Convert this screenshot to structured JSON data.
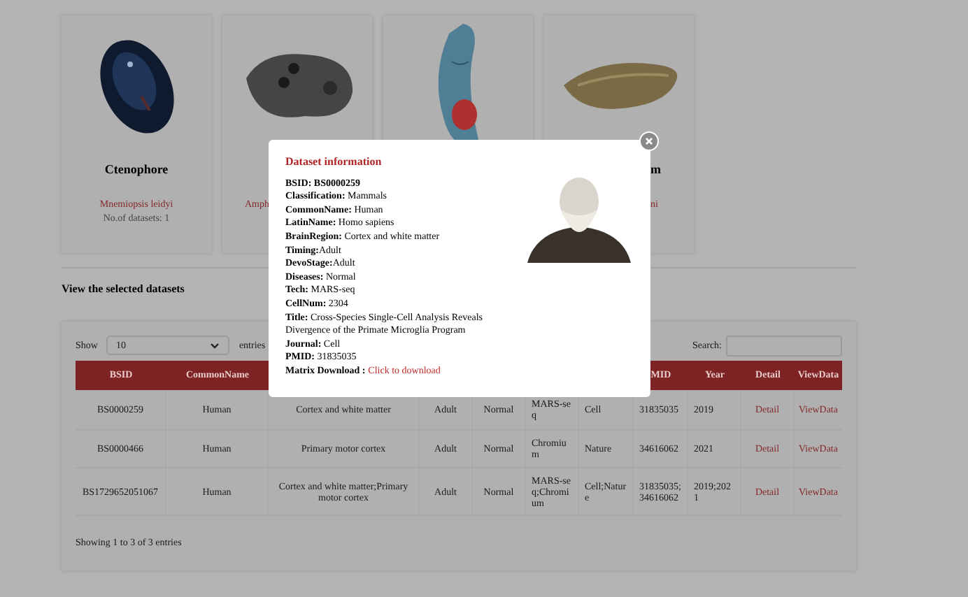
{
  "cards": [
    {
      "kind": "picture",
      "title": "Ctenophore",
      "species": "Mnemiopsis leidyi",
      "count": "No.of datasets: 1"
    },
    {
      "kind": "picture",
      "species": "Amph"
    },
    {
      "kind": "picture"
    },
    {
      "kind": "picture",
      "title": "m",
      "species": "ni"
    }
  ],
  "section_title": "View the selected datasets",
  "table": {
    "show_label": "Show",
    "page_size": "10",
    "entries_label": "entries",
    "search_label": "Search:",
    "columns": [
      {
        "label": "BSID"
      },
      {
        "label": "CommonName"
      },
      {},
      {},
      {},
      {},
      {},
      {
        "label": "MID"
      },
      {
        "label": "Year"
      },
      {
        "label": "Detail"
      },
      {
        "label": "ViewData"
      }
    ],
    "rows": [
      {
        "cells": [
          "BS0000259",
          "Human",
          "Cortex and white matter",
          "Adult",
          "Normal",
          "MARS-seq",
          "Cell",
          "31835035",
          "2019"
        ],
        "detail": "Detail",
        "view": "ViewData"
      },
      {
        "cells": [
          "BS0000466",
          "Human",
          "Primary motor cortex",
          "Adult",
          "Normal",
          "Chromium",
          "Nature",
          "34616062",
          "2021"
        ],
        "detail": "Detail",
        "view": "ViewData"
      },
      {
        "cells": [
          "BS1729652051067",
          "Human",
          "Cortex and white matter;Primary motor cortex",
          "Adult",
          "Normal",
          "MARS-seq;Chromium",
          "Cell;Nature",
          "31835035;34616062",
          "2019;2021"
        ],
        "detail": "Detail",
        "view": "ViewData"
      }
    ],
    "info": "Showing 1 to 3 of 3 entries"
  },
  "modal": {
    "title": "Dataset information",
    "lines": [
      "**BSID: BS0000259**",
      "**Classification:** Mammals",
      "**CommonName:** Human",
      "**LatinName:** Homo sapiens",
      "**BrainRegion:** Cortex and white matter",
      "**Timing:**Adult",
      "**DevoStage:**Adult",
      "**Diseases:** Normal",
      "**Tech:** MARS-seq",
      "**CellNum:** 2304",
      "**Title:** Cross-Species Single-Cell Analysis Reveals Divergence of the Primate Microglia Program",
      "**Journal:** Cell",
      "**PMID:** 31835035"
    ],
    "download_label": "Matrix Download :",
    "download_link": "Click to download"
  }
}
